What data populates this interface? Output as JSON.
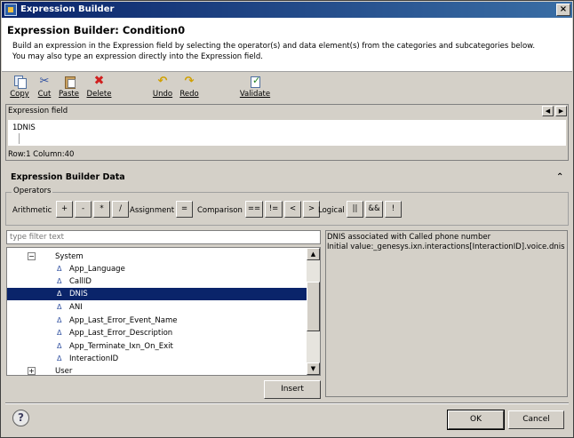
{
  "window": {
    "title": "Expression Builder",
    "close_glyph": "×"
  },
  "header": {
    "title": "Expression Builder: Condition0",
    "description_line1": "Build an expression in the Expression field by selecting the operator(s) and data element(s) from the categories and subcategories below.",
    "description_line2": "You may also type an expression directly into the Expression field."
  },
  "toolbar": {
    "copy": "Copy",
    "cut": "Cut",
    "paste": "Paste",
    "delete": "Delete",
    "undo": "Undo",
    "redo": "Redo",
    "validate": "Validate"
  },
  "expression": {
    "label": "Expression field",
    "line_number": "1",
    "content": "DNIS",
    "status": "Row:1 Column:40"
  },
  "data_section": {
    "title": "Expression Builder Data"
  },
  "operators": {
    "legend": "Operators",
    "arithmetic_label": "Arithmetic",
    "arithmetic": [
      "+",
      "-",
      "*",
      "/"
    ],
    "assignment_label": "Assignment",
    "assignment": [
      "="
    ],
    "comparison_label": "Comparison",
    "comparison": [
      "==",
      "!=",
      "<",
      ">"
    ],
    "logical_label": "Logical",
    "logical": [
      "||",
      "&&",
      "!"
    ]
  },
  "filter": {
    "placeholder": "type filter text"
  },
  "tree": {
    "expanded_glyph": "−",
    "collapsed_glyph": "+",
    "leaf_glyph": "Δ",
    "system": "System",
    "items": [
      "App_Language",
      "CallID",
      "DNIS",
      "ANI",
      "App_Last_Error_Event_Name",
      "App_Last_Error_Description",
      "App_Terminate_Ixn_On_Exit",
      "InteractionID"
    ],
    "selected": "DNIS",
    "user": "User"
  },
  "insert_button": "Insert",
  "description": {
    "line1": "DNIS associated with Called phone number",
    "line2": "Initial value:_genesys.ixn.interactions[InteractionID].voice.dnis"
  },
  "help_glyph": "?",
  "ok_button": "OK",
  "cancel_button": "Cancel"
}
